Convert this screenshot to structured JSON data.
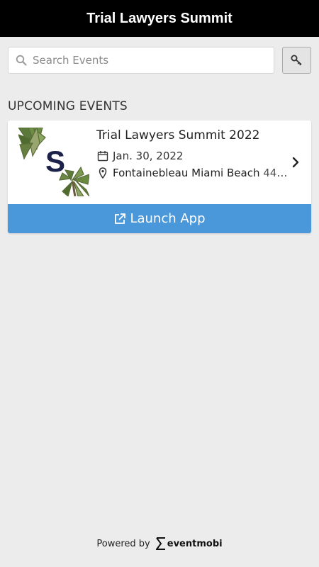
{
  "header": {
    "title": "Trial Lawyers Summit"
  },
  "search": {
    "placeholder": "Search Events",
    "value": "",
    "icon": "search-icon"
  },
  "key_button": {
    "icon": "key-icon"
  },
  "section": {
    "heading": "UPCOMING EVENTS"
  },
  "events": [
    {
      "name": "Trial Lawyers Summit 2022",
      "date": "Jan. 30, 2022",
      "location": "Fontainebleau Miami Beach",
      "location_extra": "444...",
      "thumb_letter": "S",
      "launch_label": "Launch App"
    }
  ],
  "footer": {
    "powered_by": "Powered by",
    "brand": "eventmobi"
  },
  "colors": {
    "header_bg": "#000000",
    "launch_bg": "#4a97d9",
    "page_bg": "#ececec",
    "thumb_letter": "#1b2148"
  }
}
